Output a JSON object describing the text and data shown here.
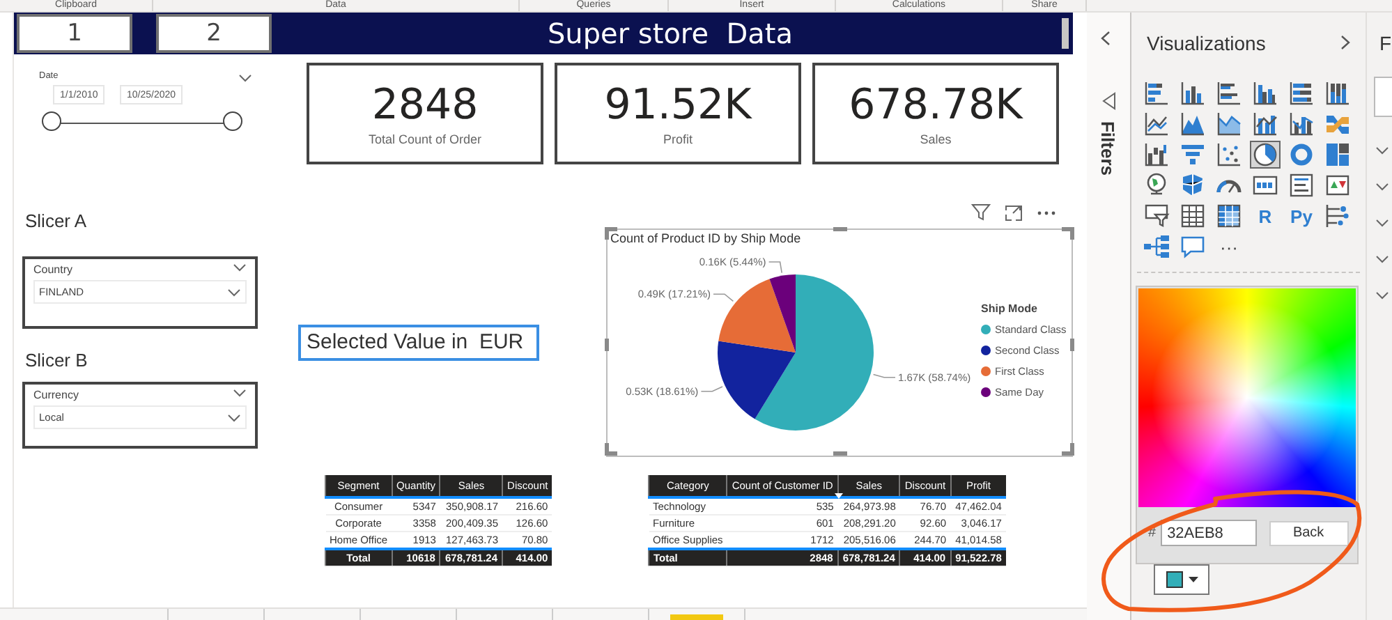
{
  "ribbon": {
    "groups": [
      "Clipboard",
      "Data",
      "Queries",
      "Insert",
      "Calculations",
      "Share"
    ]
  },
  "report": {
    "nav_buttons": [
      {
        "label": "1"
      },
      {
        "label": "2"
      }
    ],
    "title": "Super store  Data",
    "date_slicer": {
      "label": "Date",
      "start": "1/1/2010",
      "end": "10/25/2020",
      "level": 1
    },
    "cards": [
      {
        "value": "2848",
        "label": "Total Count of Order"
      },
      {
        "value": "91.52K",
        "label": "Profit"
      },
      {
        "value": "678.78K",
        "label": "Sales"
      }
    ],
    "slicers": [
      {
        "heading": "Slicer A",
        "field": "Country",
        "value": "FINLAND"
      },
      {
        "heading": "Slicer B",
        "field": "Currency",
        "value": "Local"
      }
    ],
    "selected_value": {
      "text": "Selected Value in  EUR",
      "selected": true
    },
    "pie_visual": {
      "chart_data": {
        "type": "pie",
        "title": "Count of Product ID by Ship Mode",
        "categories": [
          "Standard Class",
          "Second Class",
          "First Class",
          "Same Day"
        ],
        "values": [
          58.74,
          18.61,
          17.21,
          5.44
        ],
        "value_labels": [
          "1.67K (58.74%)",
          "0.53K (18.61%)",
          "0.49K (17.21%)",
          "0.16K (5.44%)"
        ],
        "legend": {
          "title": "Ship Mode",
          "items": [
            {
              "color": "#32aeb8"
            },
            {
              "color": "#12239e"
            },
            {
              "color": "#e66c37"
            },
            {
              "color": "#6b007b"
            }
          ]
        }
      }
    },
    "tables": [
      {
        "columns": [
          {
            "label": "Segment",
            "sorted": false
          },
          {
            "label": "Quantity",
            "sorted": false
          },
          {
            "label": "Sales",
            "sorted": false
          },
          {
            "label": "Discount",
            "sorted": false
          }
        ],
        "rows": [
          [
            "Consumer",
            "5347",
            "350,908.17",
            "216.60"
          ],
          [
            "Corporate",
            "3358",
            "200,409.35",
            "126.60"
          ],
          [
            "Home Office",
            "1913",
            "127,463.73",
            "70.80"
          ]
        ],
        "total": [
          "Total",
          "10618",
          "678,781.24",
          "414.00"
        ]
      },
      {
        "columns": [
          {
            "label": "Category",
            "sorted": false
          },
          {
            "label": "Count of Customer ID",
            "sorted": false
          },
          {
            "label": "Sales",
            "sorted": true
          },
          {
            "label": "Discount",
            "sorted": false
          },
          {
            "label": "Profit",
            "sorted": false
          }
        ],
        "rows": [
          [
            "Technology",
            "535",
            "264,973.98",
            "76.70",
            "47,462.04"
          ],
          [
            "Furniture",
            "601",
            "208,291.20",
            "92.60",
            "3,046.17"
          ],
          [
            "Office Supplies",
            "1712",
            "205,516.06",
            "244.70",
            "41,014.58"
          ]
        ],
        "total": [
          "Total",
          "2848",
          "678,781.24",
          "414.00",
          "91,522.78"
        ]
      }
    ],
    "page_tabs": [
      {
        "selected": false
      },
      {
        "selected": false
      },
      {
        "selected": false
      },
      {
        "selected": false
      },
      {
        "selected": false
      },
      {
        "selected": false
      },
      {
        "selected": true
      }
    ]
  },
  "filters_pane": {
    "title": "Filters"
  },
  "visualizations_pane": {
    "title": "Visualizations",
    "icons": [
      {
        "kind": "graphic",
        "selected": false
      },
      {
        "kind": "graphic",
        "selected": false
      },
      {
        "kind": "graphic",
        "selected": false
      },
      {
        "kind": "graphic",
        "selected": false
      },
      {
        "kind": "graphic",
        "selected": false
      },
      {
        "kind": "graphic",
        "selected": false
      },
      {
        "kind": "graphic",
        "selected": false
      },
      {
        "kind": "graphic",
        "selected": false
      },
      {
        "kind": "graphic",
        "selected": false
      },
      {
        "kind": "graphic",
        "selected": false
      },
      {
        "kind": "graphic",
        "selected": false
      },
      {
        "kind": "graphic",
        "selected": false
      },
      {
        "kind": "graphic",
        "selected": false
      },
      {
        "kind": "graphic",
        "selected": false
      },
      {
        "kind": "graphic",
        "selected": false
      },
      {
        "kind": "graphic",
        "selected": true
      },
      {
        "kind": "graphic",
        "selected": false
      },
      {
        "kind": "graphic",
        "selected": false
      },
      {
        "kind": "graphic",
        "selected": false
      },
      {
        "kind": "graphic",
        "selected": false
      },
      {
        "kind": "graphic",
        "selected": false
      },
      {
        "kind": "graphic",
        "selected": false
      },
      {
        "kind": "graphic",
        "selected": false
      },
      {
        "kind": "graphic",
        "selected": false
      },
      {
        "kind": "graphic",
        "selected": false
      },
      {
        "kind": "graphic",
        "selected": false
      },
      {
        "kind": "graphic",
        "selected": false
      },
      {
        "kind": "glyph",
        "label": "R",
        "selected": false
      },
      {
        "kind": "glyph",
        "label": "Py",
        "selected": false
      },
      {
        "kind": "graphic",
        "selected": false
      },
      {
        "kind": "graphic",
        "selected": false
      },
      {
        "kind": "graphic",
        "selected": false
      },
      {
        "kind": "glyph",
        "label": "···",
        "selected": false
      }
    ],
    "color_picker": {
      "hex": "32AEB8",
      "hash": "#",
      "button": "Back"
    }
  },
  "fields_pane": {
    "title": "F"
  }
}
